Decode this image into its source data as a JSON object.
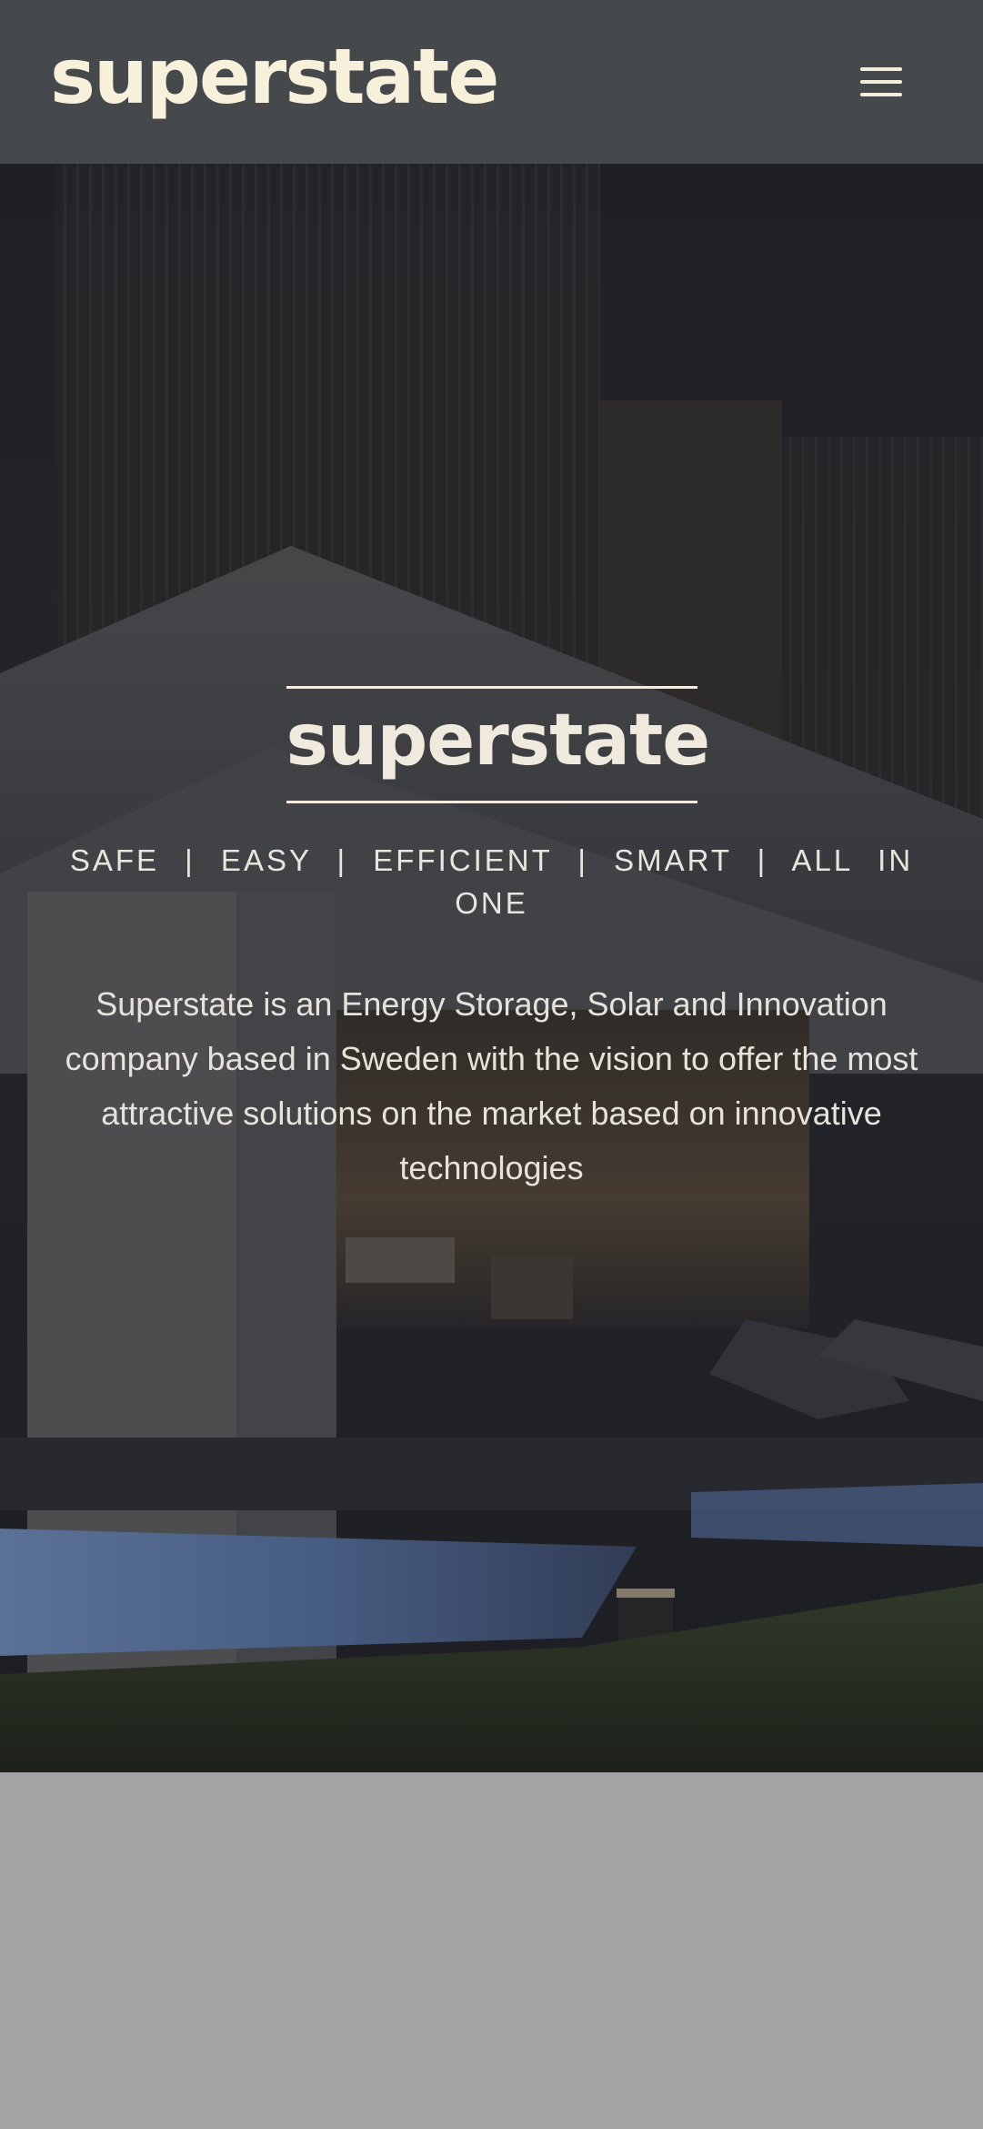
{
  "header": {
    "logo_text": "superstate",
    "menu_icon": "hamburger-menu-icon"
  },
  "hero": {
    "title": "superstate",
    "tagline": "SAFE | EASY | EFFICIENT | SMART | ALL IN ONE",
    "description": "Superstate is an Energy Storage, Solar and Innovation company based in Sweden with the vision to offer the most attractive solutions on the market based on innovative technologies"
  },
  "colors": {
    "header_bg": "#46494c",
    "logo": "#f7f1dc",
    "hero_text": "#eee9dc",
    "page_bg": "#a3a3a5"
  }
}
